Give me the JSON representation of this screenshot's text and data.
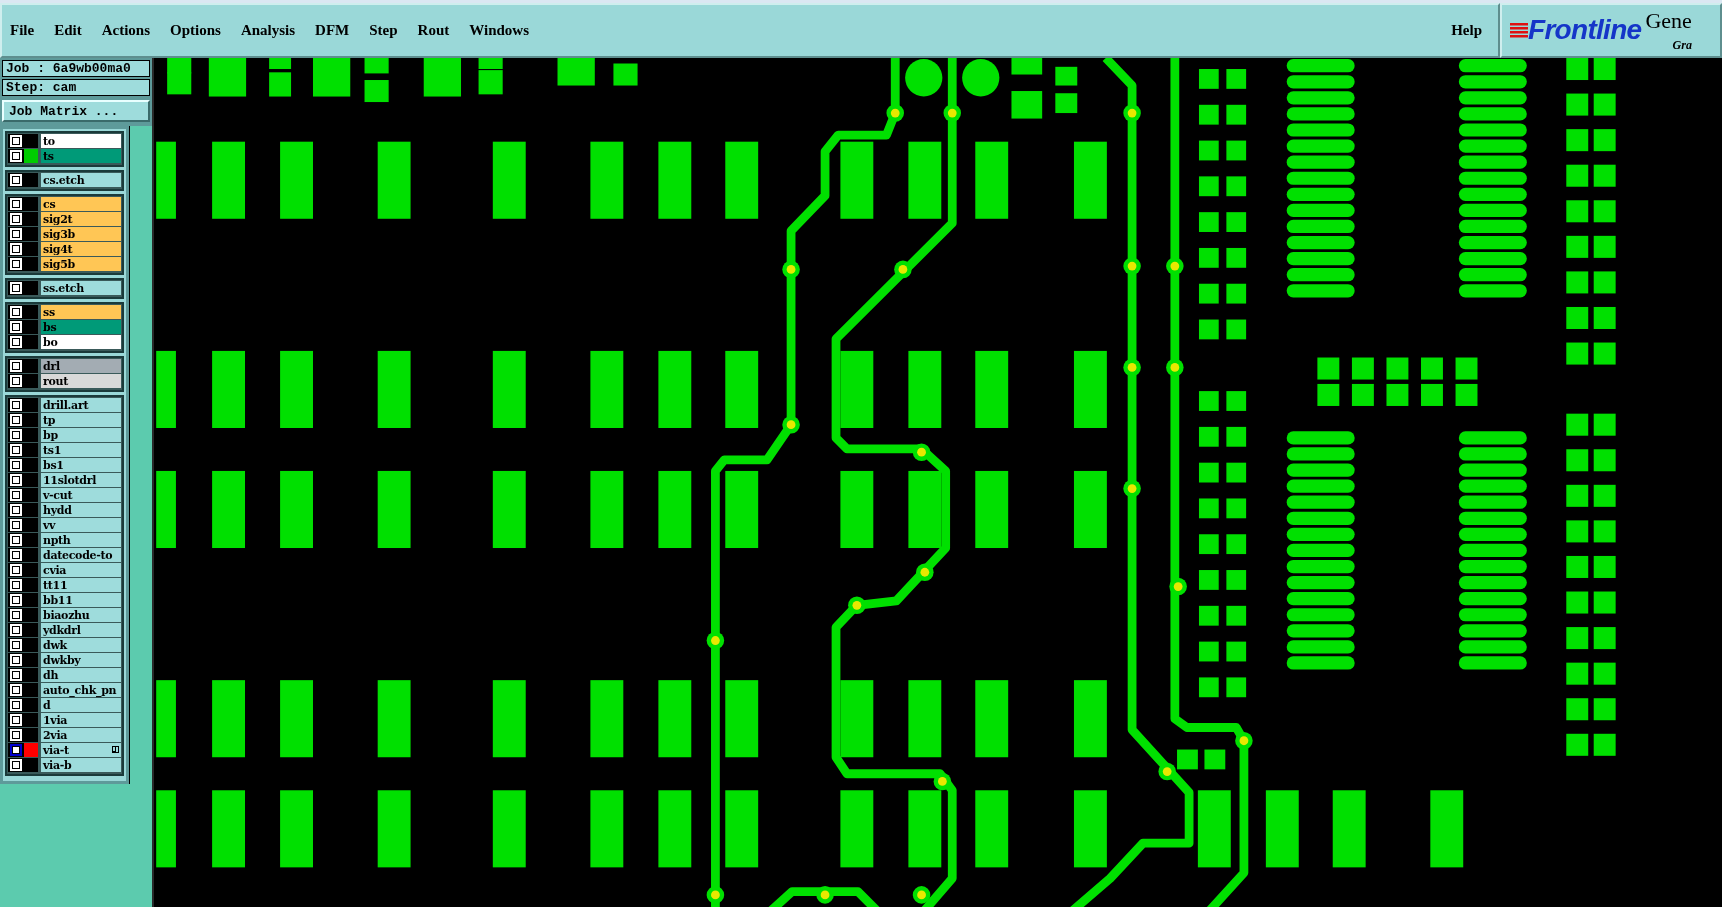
{
  "menu": [
    "File",
    "Edit",
    "Actions",
    "Options",
    "Analysis",
    "DFM",
    "Step",
    "Rout",
    "Windows"
  ],
  "help": "Help",
  "logo": {
    "brand": "Frontline",
    "product": "Gene",
    "subtitle": "Gra"
  },
  "job": "Job : 6a9wb00ma0",
  "step": "Step: cam",
  "job_matrix_button": "Job Matrix ...",
  "layer_groups": [
    [
      {
        "name": "to",
        "color": "#ffffff",
        "work": false
      },
      {
        "name": "ts",
        "color": "#009a78",
        "swatch": {
          "color": "#00cc00"
        },
        "work": false
      }
    ],
    [
      {
        "name": "cs.etch",
        "color": "#9edcdc",
        "work": false
      }
    ],
    [
      {
        "name": "cs",
        "color": "#ffc655",
        "work": false
      },
      {
        "name": "sig2t",
        "color": "#ffc655",
        "work": false
      },
      {
        "name": "sig3b",
        "color": "#ffc655",
        "work": false
      },
      {
        "name": "sig4t",
        "color": "#ffc655",
        "work": false
      },
      {
        "name": "sig5b",
        "color": "#ffc655",
        "work": false
      }
    ],
    [
      {
        "name": "ss.etch",
        "color": "#9edcdc",
        "work": false
      }
    ],
    [
      {
        "name": "ss",
        "color": "#ffc655",
        "work": false
      },
      {
        "name": "bs",
        "color": "#009a78",
        "work": false
      },
      {
        "name": "bo",
        "color": "#ffffff",
        "work": false
      }
    ],
    [
      {
        "name": "drl",
        "color": "#a3acb3",
        "work": false
      },
      {
        "name": "rout",
        "color": "#d9d9d9",
        "work": false
      }
    ],
    [
      {
        "name": "drill.art",
        "color": "#9edcdc",
        "work": false
      },
      {
        "name": "tp",
        "color": "#9edcdc",
        "work": false
      },
      {
        "name": "bp",
        "color": "#9edcdc",
        "work": false
      },
      {
        "name": "ts1",
        "color": "#9edcdc",
        "work": false
      },
      {
        "name": "bs1",
        "color": "#9edcdc",
        "work": false
      },
      {
        "name": "11slotdrl",
        "color": "#9edcdc",
        "work": false
      },
      {
        "name": "v-cut",
        "color": "#9edcdc",
        "work": false
      },
      {
        "name": "hydd",
        "color": "#9edcdc",
        "work": false
      },
      {
        "name": "vv",
        "color": "#9edcdc",
        "work": false
      },
      {
        "name": "npth",
        "color": "#9edcdc",
        "work": false
      },
      {
        "name": "datecode-to",
        "color": "#9edcdc",
        "work": false
      },
      {
        "name": "cvia",
        "color": "#9edcdc",
        "work": false
      },
      {
        "name": "tt11",
        "color": "#9edcdc",
        "work": false
      },
      {
        "name": "bb11",
        "color": "#9edcdc",
        "work": false
      },
      {
        "name": "biaozhu",
        "color": "#9edcdc",
        "work": false
      },
      {
        "name": "ydkdrl",
        "color": "#9edcdc",
        "work": false
      },
      {
        "name": "dwk",
        "color": "#9edcdc",
        "work": false
      },
      {
        "name": "dwkby",
        "color": "#9edcdc",
        "work": false
      },
      {
        "name": "dh",
        "color": "#9edcdc",
        "work": false
      },
      {
        "name": "auto_chk_pn",
        "color": "#9edcdc",
        "work": false
      },
      {
        "name": "d",
        "color": "#9edcdc",
        "work": false
      },
      {
        "name": "1via",
        "color": "#9edcdc",
        "work": false
      },
      {
        "name": "2via",
        "color": "#9edcdc",
        "work": false
      },
      {
        "name": "via-t",
        "color": "#9edcdc",
        "swatch": {
          "color": "#ff0000"
        },
        "work": true
      },
      {
        "name": "via-b",
        "color": "#9edcdc",
        "work": false
      }
    ]
  ]
}
